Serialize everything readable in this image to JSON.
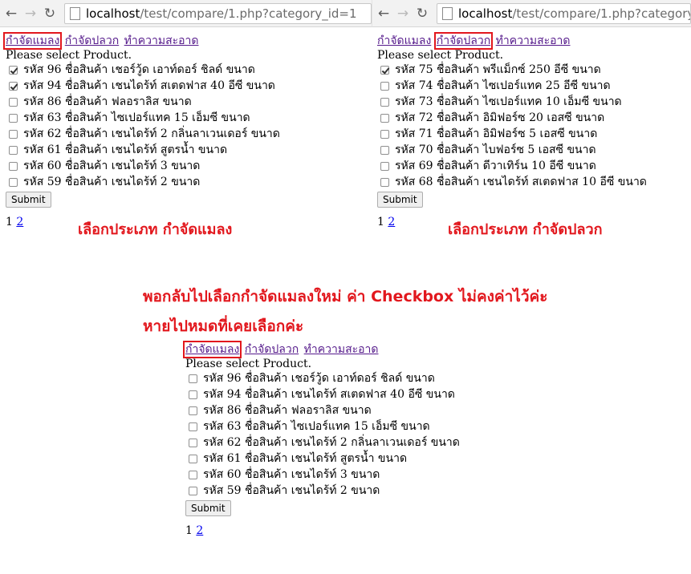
{
  "left_window": {
    "url_host": "localhost",
    "url_path": "/test/compare/1.php?category_id=1"
  },
  "right_window": {
    "url_host": "localhost",
    "url_path": "/test/compare/1.php?category_"
  },
  "categories": [
    "กำจัดแมลง",
    "กำจัดปลวก",
    "ทำความสะอาด"
  ],
  "prompt_text": "Please select Product.",
  "submit_label": "Submit",
  "pager": {
    "current": "1",
    "next": "2"
  },
  "panel_top_left": {
    "products": [
      {
        "label": "รหัส 96 ชื่อสินค้า เชอร์วู้ด เอาท์ดอร์ ชิลด์ ขนาด",
        "checked": true
      },
      {
        "label": "รหัส 94 ชื่อสินค้า เชนไดร้ท์ สเตดฟาส 40 อีซี ขนาด",
        "checked": true
      },
      {
        "label": "รหัส 86 ชื่อสินค้า ฟลอราลิส ขนาด",
        "checked": false
      },
      {
        "label": "รหัส 63 ชื่อสินค้า ไซเปอร์แทค 15 เอ็มซี ขนาด",
        "checked": false
      },
      {
        "label": "รหัส 62 ชื่อสินค้า เชนไดร้ท์ 2 กลิ่นลาเวนเดอร์ ขนาด",
        "checked": false
      },
      {
        "label": "รหัส 61 ชื่อสินค้า เชนไดร้ท์ สูตรน้ำ ขนาด",
        "checked": false
      },
      {
        "label": "รหัส 60 ชื่อสินค้า เชนไดร้ท์ 3 ขนาด",
        "checked": false
      },
      {
        "label": "รหัส 59 ชื่อสินค้า เชนไดร้ท์ 2 ขนาด",
        "checked": false
      }
    ]
  },
  "panel_top_right": {
    "products": [
      {
        "label": "รหัส 75 ชื่อสินค้า พรีแม็กซ์ 250 อีซี ขนาด",
        "checked": true
      },
      {
        "label": "รหัส 74 ชื่อสินค้า ไซเปอร์แทค 25 อีซี ขนาด",
        "checked": false
      },
      {
        "label": "รหัส 73 ชื่อสินค้า ไซเปอร์แทค 10 เอ็มซี ขนาด",
        "checked": false
      },
      {
        "label": "รหัส 72 ชื่อสินค้า อิมิฟอร์ซ 20 เอสซี ขนาด",
        "checked": false
      },
      {
        "label": "รหัส 71 ชื่อสินค้า อิมิฟอร์ซ 5 เอสซี ขนาด",
        "checked": false
      },
      {
        "label": "รหัส 70 ชื่อสินค้า ไบฟอร์ซ 5 เอสซี ขนาด",
        "checked": false
      },
      {
        "label": "รหัส 69 ชื่อสินค้า ดีวาเทิร์น 10 อีซี ขนาด",
        "checked": false
      },
      {
        "label": "รหัส 68 ชื่อสินค้า เชนไดร้ท์ สเตดฟาส 10 อีซี ขนาด",
        "checked": false
      }
    ]
  },
  "panel_bottom": {
    "products": [
      {
        "label": "รหัส 96 ชื่อสินค้า เชอร์วู้ด เอาท์ดอร์ ชิลด์ ขนาด",
        "checked": false
      },
      {
        "label": "รหัส 94 ชื่อสินค้า เชนไดร้ท์ สเตดฟาส 40 อีซี ขนาด",
        "checked": false
      },
      {
        "label": "รหัส 86 ชื่อสินค้า ฟลอราลิส ขนาด",
        "checked": false
      },
      {
        "label": "รหัส 63 ชื่อสินค้า ไซเปอร์แทค 15 เอ็มซี ขนาด",
        "checked": false
      },
      {
        "label": "รหัส 62 ชื่อสินค้า เชนไดร้ท์ 2 กลิ่นลาเวนเดอร์ ขนาด",
        "checked": false
      },
      {
        "label": "รหัส 61 ชื่อสินค้า เชนไดร้ท์ สูตรน้ำ ขนาด",
        "checked": false
      },
      {
        "label": "รหัส 60 ชื่อสินค้า เชนไดร้ท์ 3 ขนาด",
        "checked": false
      },
      {
        "label": "รหัส 59 ชื่อสินค้า เชนไดร้ท์ 2 ขนาด",
        "checked": false
      }
    ]
  },
  "annotations": {
    "left_caption": "เลือกประเภท กำจัดแมลง",
    "right_caption": "เลือกประเภท กำจัดปลวก",
    "bottom_line1": "พอกลับไปเลือกกำจัดแมลงใหม่ ค่า Checkbox  ไม่คงค่าไว้ค่ะ",
    "bottom_line2": "หายไปหมดที่เคยเลือกค่ะ"
  },
  "colors": {
    "annotation_red": "#e2171d",
    "visited_link": "#551a8b",
    "link": "#0000ee"
  }
}
